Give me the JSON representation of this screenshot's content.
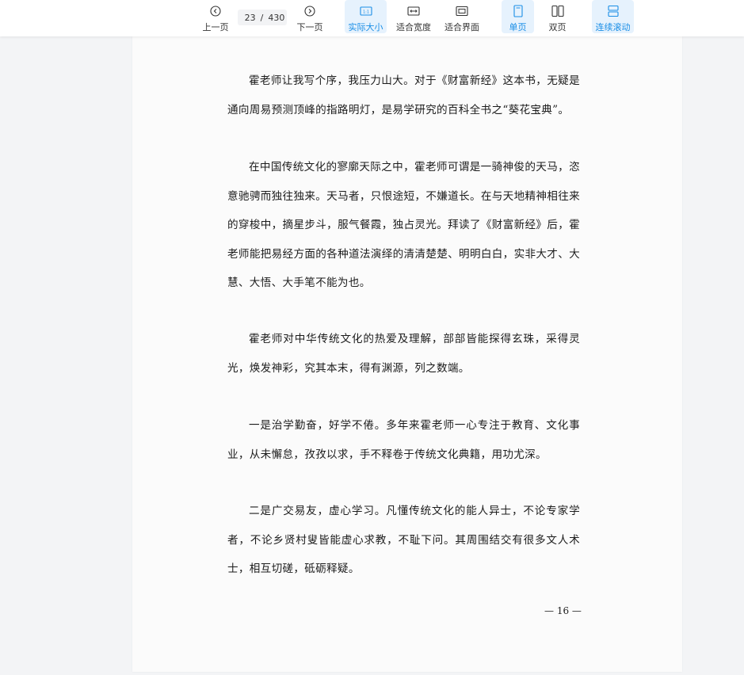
{
  "toolbar": {
    "prev_label": "上一页",
    "next_label": "下一页",
    "current_page": "23",
    "separator": "/",
    "total_pages": "430",
    "actual_size_label": "实际大小",
    "fit_width_label": "适合宽度",
    "fit_page_label": "适合界面",
    "single_page_label": "单页",
    "double_page_label": "双页",
    "continuous_label": "连续滚动",
    "accent_color": "#1a8ee6"
  },
  "document": {
    "paragraphs": [
      "霍老师让我写个序，我压力山大。对于《财富新经》这本书，无疑是通向周易预测顶峰的指路明灯，是易学研究的百科全书之“葵花宝典”。",
      "在中国传统文化的寥廓天际之中，霍老师可谓是一骑神俊的天马，恣意驰骋而独往独来。天马者，只恨途短，不嫌道长。在与天地精神相往来的穿梭中，摘星步斗，服气餐霞，独占灵光。拜读了《财富新经》后，霍老师能把易经方面的各种道法演绎的清清楚楚、明明白白，实非大才、大慧、大悟、大手笔不能为也。",
      "霍老师对中华传统文化的热爱及理解，部部皆能探得玄珠，采得灵光，焕发神彩，究其本末，得有渊源，列之数端。",
      "一是治学勤奋，好学不倦。多年来霍老师一心专注于教育、文化事业，从未懈怠，孜孜以求，手不释卷于传统文化典籍，用功尤深。",
      "二是广交易友，虚心学习。凡懂传统文化的能人异士，不论专家学者，不论乡贤村叟皆能虚心求教，不耻下问。其周围结交有很多文人术士，相互切磋，砥砺释疑。"
    ],
    "page_number": "— 16 —"
  }
}
